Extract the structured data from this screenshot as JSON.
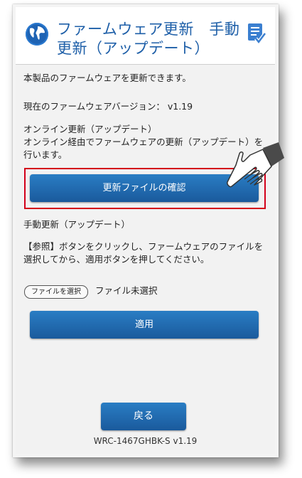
{
  "header": {
    "title": "ファームウェア更新　手動更新（アップデート）",
    "globe_icon": "globe-icon",
    "update_icon": "update-check-icon"
  },
  "intro": "本製品のファームウェアを更新できます。",
  "current_version": "現在のファームウェアバージョン： v1.19",
  "online": {
    "heading": "オンライン更新（アップデート）",
    "description_line1": "オンライン経由でファームウェアの更新（アップデート）を",
    "description_line2": "行います。",
    "check_button": "更新ファイルの確認"
  },
  "manual": {
    "heading": "手動更新（アップデート）",
    "description_line1": "【参照】ボタンをクリックし、ファームウェアのファイルを",
    "description_line2": "選択してから、適用ボタンを押してください。",
    "file_button": "ファイルを選択",
    "file_status": "ファイル未選択",
    "apply_button": "適用"
  },
  "footer": {
    "back_button": "戻る",
    "model": "WRC-1467GHBK-S v1.19"
  },
  "colors": {
    "accent": "#1e5fa8",
    "button": "#1f65a8",
    "highlight_frame": "#d3001a"
  }
}
